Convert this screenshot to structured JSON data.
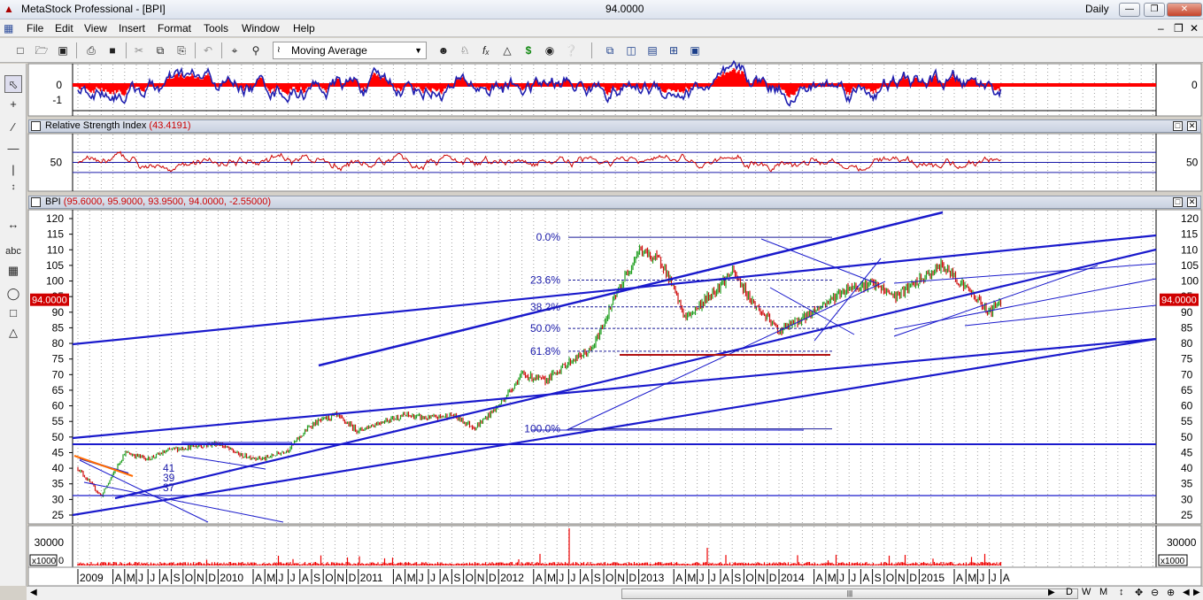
{
  "app": {
    "title": "MetaStock Professional - [BPI]",
    "center_value": "94.0000",
    "periodicity": "Daily"
  },
  "menu": [
    "File",
    "Edit",
    "View",
    "Insert",
    "Format",
    "Tools",
    "Window",
    "Help"
  ],
  "toolbar": {
    "indicator_select": "Moving Average"
  },
  "panels": {
    "macd": {
      "ticks_left": [
        "0",
        "-1"
      ],
      "tick_right": "0"
    },
    "rsi": {
      "title": "Relative Strength Index",
      "value": "(43.4191)",
      "tick": "50"
    },
    "price": {
      "symbol": "BPI",
      "ohlc": "(95.6000, 95.9000, 93.9500, 94.0000, -2.55000)",
      "last_price": "94.0000",
      "y_ticks": [
        "120",
        "115",
        "110",
        "105",
        "100",
        "95",
        "90",
        "85",
        "80",
        "75",
        "70",
        "65",
        "60",
        "55",
        "50",
        "45",
        "40",
        "35",
        "30",
        "25"
      ],
      "fib_levels": [
        {
          "label": "0.0%",
          "value": 114
        },
        {
          "label": "23.6%",
          "value": 100.3
        },
        {
          "label": "38.2%",
          "value": 91.7
        },
        {
          "label": "50.0%",
          "value": 84.8
        },
        {
          "label": "61.8%",
          "value": 77.5
        },
        {
          "label": "100.0%",
          "value": 52.6
        }
      ],
      "wave_labels": [
        "41",
        "39",
        "37"
      ]
    },
    "volume": {
      "tick": "30000",
      "multiplier": "x1000",
      "zero": "0"
    }
  },
  "x_axis": {
    "labels": [
      "2009",
      "A",
      "M",
      "J",
      "J",
      "A",
      "S",
      "O",
      "N",
      "D",
      "2010",
      "A",
      "M",
      "J",
      "J",
      "A",
      "S",
      "O",
      "N",
      "D",
      "2011",
      "A",
      "M",
      "J",
      "J",
      "A",
      "S",
      "O",
      "N",
      "D",
      "2012",
      "A",
      "M",
      "J",
      "J",
      "A",
      "S",
      "O",
      "N",
      "D",
      "2013",
      "A",
      "M",
      "J",
      "J",
      "A",
      "S",
      "O",
      "N",
      "D",
      "2014",
      "A",
      "M",
      "J",
      "J",
      "A",
      "S",
      "O",
      "N",
      "D",
      "2015",
      "A",
      "M",
      "J",
      "J",
      "A"
    ]
  },
  "colors": {
    "up_bar": "#22a022",
    "down_bar": "#d01010",
    "trend_line": "#1a1acc",
    "rsi_line": "#cc0000",
    "macd_hist": "#ff0000",
    "macd_line": "#2020b0"
  },
  "chart_data": [
    {
      "type": "line",
      "title": "BPI",
      "ylim": [
        25,
        120
      ],
      "x_range": [
        "2009-01",
        "2015-08"
      ],
      "last_close": 94.0,
      "series": [
        {
          "name": "BPI",
          "x": [
            "2009-01",
            "2009-03",
            "2009-05",
            "2009-07",
            "2009-09",
            "2009-11",
            "2010-01",
            "2010-03",
            "2010-05",
            "2010-07",
            "2010-09",
            "2010-11",
            "2011-01",
            "2011-03",
            "2011-05",
            "2011-07",
            "2011-09",
            "2011-11",
            "2012-01",
            "2012-03",
            "2012-05",
            "2012-07",
            "2012-09",
            "2012-11",
            "2013-01",
            "2013-03",
            "2013-05",
            "2013-07",
            "2013-09",
            "2013-11",
            "2014-01",
            "2014-03",
            "2014-05",
            "2014-07",
            "2014-09",
            "2014-11",
            "2015-01",
            "2015-03",
            "2015-05",
            "2015-07",
            "2015-08"
          ],
          "values": [
            40,
            31,
            45,
            43,
            46,
            47,
            48,
            44,
            43,
            46,
            54,
            57,
            52,
            55,
            57,
            56,
            57,
            53,
            60,
            70,
            68,
            74,
            78,
            95,
            110,
            106,
            88,
            95,
            103,
            92,
            84,
            88,
            93,
            98,
            99,
            95,
            100,
            105,
            98,
            90,
            94
          ]
        }
      ]
    },
    {
      "type": "line",
      "title": "Relative Strength Index",
      "ylim": [
        0,
        100
      ],
      "last_value": 43.4191
    }
  ]
}
